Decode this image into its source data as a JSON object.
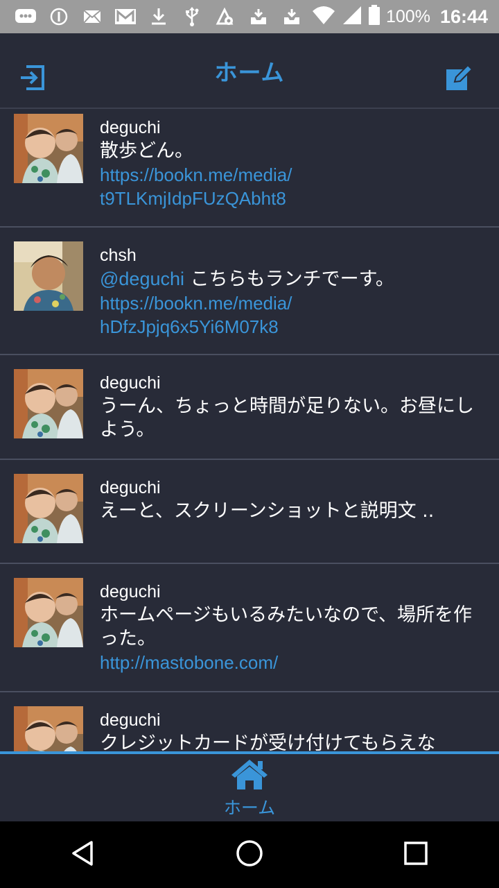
{
  "status_bar": {
    "battery": "100%",
    "time": "16:44",
    "icons": [
      "chat-bubble-icon",
      "info-icon",
      "mail-icon",
      "gmail-icon",
      "download-icon",
      "usb-icon",
      "sync-icon",
      "inbox-icon",
      "inbox-icon",
      "wifi-icon",
      "signal-icon",
      "battery-icon"
    ]
  },
  "header": {
    "title": "ホーム",
    "left_icon": "logout-icon",
    "right_icon": "compose-icon"
  },
  "feed": {
    "posts": [
      {
        "username": "deguchi",
        "text": "散歩どん。",
        "link": "https://bookn.me/media/\nt9TLKmjIdpFUzQAbht8",
        "avatar": "child-avatar"
      },
      {
        "username": "chsh",
        "mention": "@deguchi",
        "text": " こちらもランチでーす。",
        "link": "https://bookn.me/media/\nhDfzJpjq6x5Yi6M07k8",
        "avatar": "man-avatar"
      },
      {
        "username": "deguchi",
        "text": "うーん、ちょっと時間が足りない。お昼にしよう。",
        "avatar": "child-avatar"
      },
      {
        "username": "deguchi",
        "text": "えーと、スクリーンショットと説明文 ..",
        "avatar": "child-avatar"
      },
      {
        "username": "deguchi",
        "text": "ホームページもいるみたいなので、場所を作った。",
        "link": "http://mastobone.com/",
        "avatar": "child-avatar"
      },
      {
        "username": "deguchi",
        "text": "クレジットカードが受け付けてもらえな",
        "avatar": "child-avatar"
      }
    ]
  },
  "tabbar": {
    "home_label": "ホーム",
    "home_icon": "home-icon"
  },
  "navbar": {
    "icons": [
      "back-icon",
      "home-circle-icon",
      "recents-icon"
    ]
  },
  "colors": {
    "background": "#282b38",
    "accent": "#3a95d9",
    "status_bar": "#9c9c9c"
  }
}
